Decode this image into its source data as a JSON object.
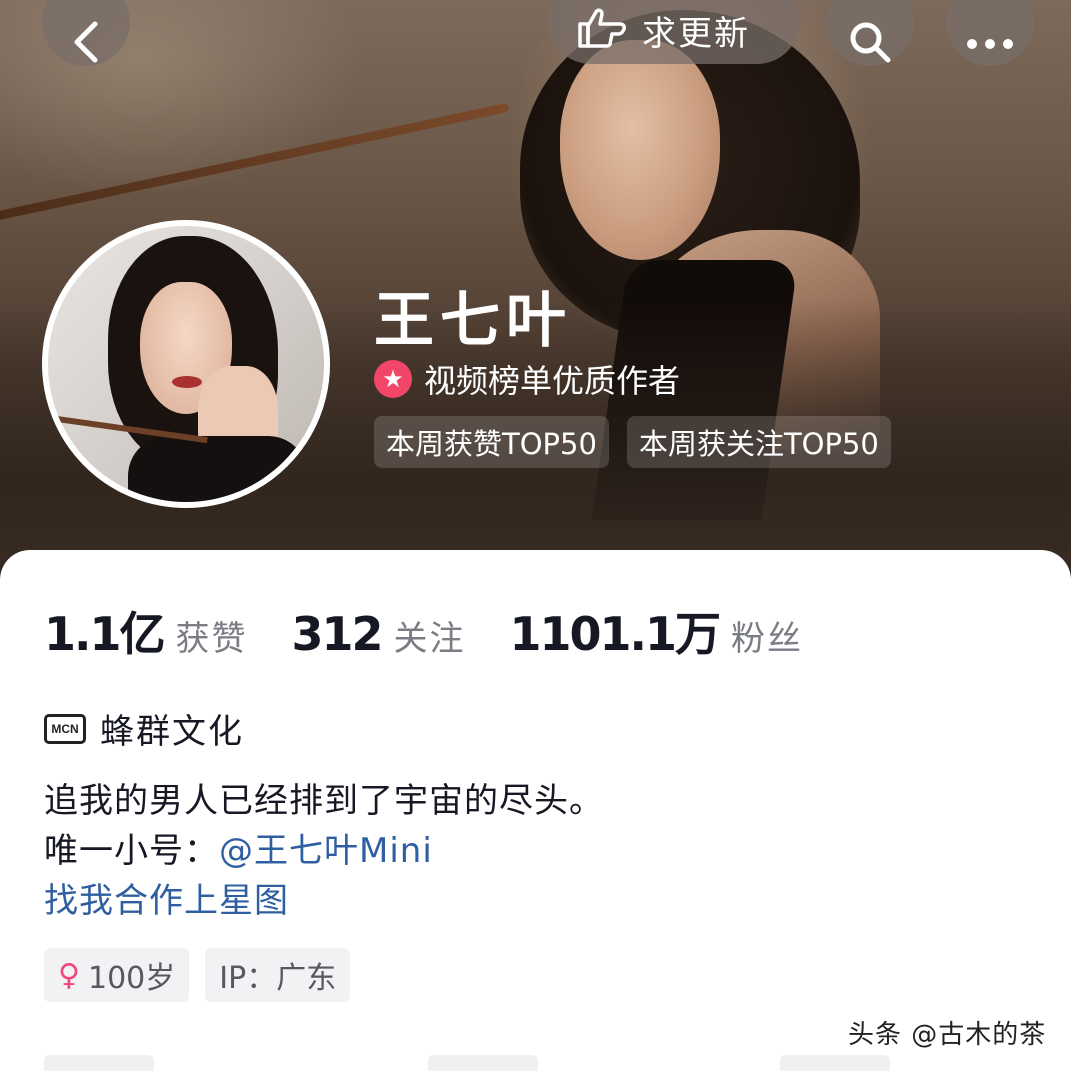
{
  "header": {
    "request_update_label": "求更新",
    "back_icon": "chevron-left-icon",
    "search_icon": "search-icon",
    "more_icon": "more-dots-icon",
    "hand_icon": "pointing-hand-icon"
  },
  "profile": {
    "name": "王七叶",
    "quality_badge_label": "视频榜单优质作者",
    "rank_tags": [
      "本周获赞TOP50",
      "本周获关注TOP50"
    ]
  },
  "stats": [
    {
      "value": "1.1亿",
      "label": "获赞"
    },
    {
      "value": "312",
      "label": "关注"
    },
    {
      "value": "1101.1万",
      "label": "粉丝"
    }
  ],
  "mcn": {
    "badge": "MCN",
    "org_name": "蜂群文化"
  },
  "bio": {
    "line1": "追我的男人已经排到了宇宙的尽头。",
    "line2_prefix": "唯一小号：",
    "line2_mention": "@王七叶Mini",
    "link": "找我合作上星图"
  },
  "tags": {
    "age_icon": "♀",
    "age": "100岁",
    "ip": "IP：广东"
  },
  "watermark": "头条 @古木的茶",
  "colors": {
    "accent_link": "#2f5fa0",
    "badge_pink": "#f2456a",
    "female_pink": "#f0467a",
    "text_primary": "#161823",
    "text_secondary": "#7b7d85"
  }
}
